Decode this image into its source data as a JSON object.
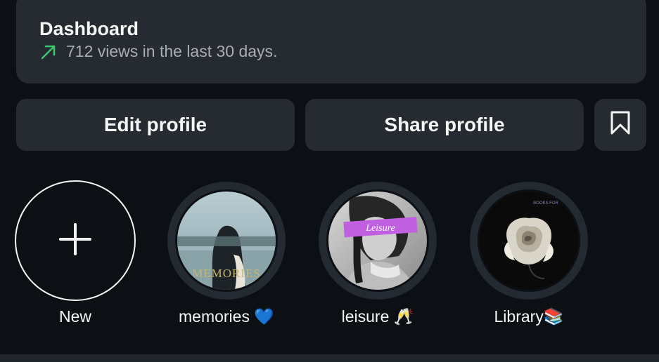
{
  "dashboard": {
    "title": "Dashboard",
    "stats": "712 views in the last 30 days.",
    "trend_color": "#3ec46d"
  },
  "actions": {
    "edit_label": "Edit profile",
    "share_label": "Share profile",
    "bookmark_icon": "bookmark-icon"
  },
  "highlights": [
    {
      "label": "New",
      "icon": "plus-icon"
    },
    {
      "label": "memories 💙",
      "overlay_text": "MEMORIES"
    },
    {
      "label": "leisure 🥂",
      "overlay_text": "Leisure"
    },
    {
      "label": "Library📚",
      "overlay_text": "BOOKS FOR"
    }
  ],
  "colors": {
    "background": "#0c1014",
    "card": "#262b31",
    "text": "#f5f5f5",
    "muted": "#a8adb3"
  }
}
